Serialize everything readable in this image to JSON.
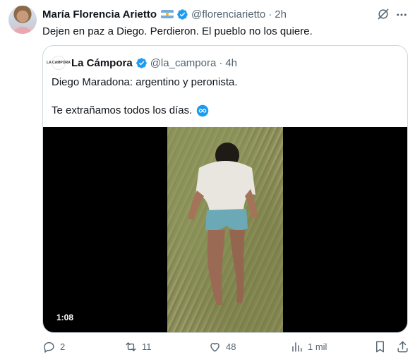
{
  "tweet": {
    "author_name": "María Florencia Arietto",
    "handle": "@florenciarietto",
    "time": "2h",
    "text": "Dejen en paz a Diego. Perdieron. El pueblo no los quiere."
  },
  "quoted": {
    "author_name": "La Cámpora",
    "avatar_text": "LA CAMPORA",
    "handle": "@la_campora",
    "time": "4h",
    "line1": "Diego Maradona: argentino y peronista.",
    "line2": "Te extrañamos todos los días.",
    "video_duration": "1:08"
  },
  "actions": {
    "replies": "2",
    "retweets": "11",
    "likes": "48",
    "views": "1 mil"
  },
  "colors": {
    "verified": "#1d9bf0",
    "text": "#0f1419",
    "muted": "#536471",
    "border": "#cfd9de"
  },
  "icons": [
    "grok-icon",
    "more-icon",
    "verified-icon",
    "argentina-flag-icon",
    "infinity-icon",
    "reply-icon",
    "retweet-icon",
    "like-icon",
    "views-icon",
    "bookmark-icon",
    "share-icon"
  ]
}
